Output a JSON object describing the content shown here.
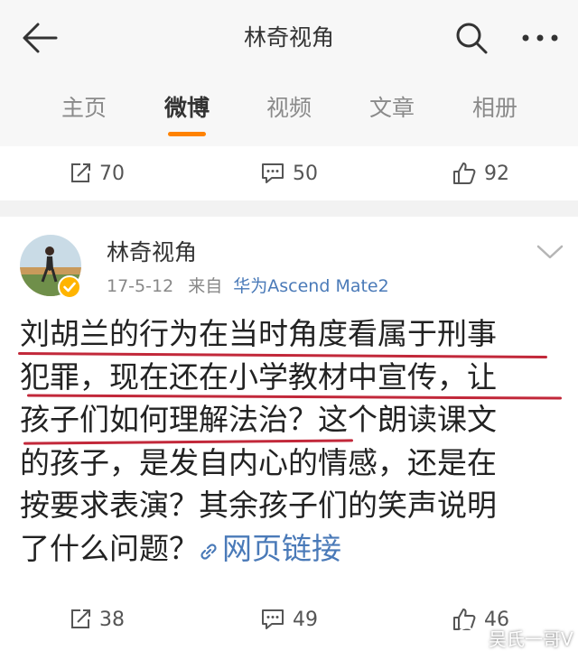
{
  "header": {
    "title": "林奇视角",
    "icons": [
      "back-arrow-icon",
      "search-icon",
      "more-icon"
    ]
  },
  "tabs": [
    {
      "label": "主页",
      "active": false
    },
    {
      "label": "微博",
      "active": true
    },
    {
      "label": "视频",
      "active": false
    },
    {
      "label": "文章",
      "active": false
    },
    {
      "label": "相册",
      "active": false
    }
  ],
  "accent_color": "#ff8200",
  "link_color": "#4a7ab8",
  "underline_color": "#c2283a",
  "prev_post_actions": {
    "reposts": "70",
    "comments": "50",
    "likes": "92"
  },
  "post": {
    "author": "林奇视角",
    "date": "17-5-12",
    "from_label": "来自",
    "source": "华为Ascend Mate2",
    "lines": [
      "刘胡兰的行为在当时角度看属于刑事",
      "犯罪，现在还在小学教材中宣传，让",
      "孩子们如何理解法治？这个朗读课文",
      "的孩子，是发自内心的情感，还是在",
      "按要求表演？其余孩子们的笑声说明",
      "了什么问题？"
    ],
    "link_text": "网页链接",
    "actions": {
      "reposts": "38",
      "comments": "49",
      "likes": "46"
    }
  },
  "watermark": "吴氏一哥V"
}
